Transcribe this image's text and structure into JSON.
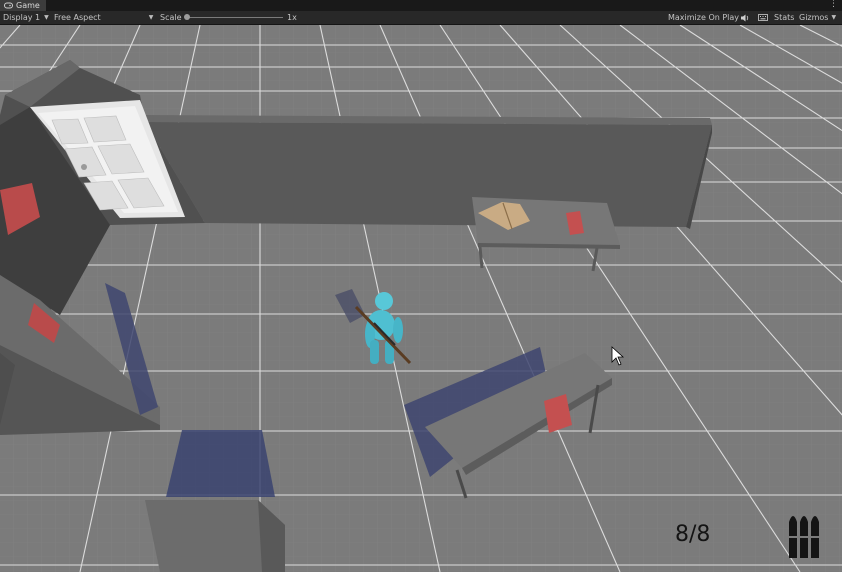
{
  "tab": {
    "title": "Game",
    "icon": "gamepad-icon"
  },
  "toolbar": {
    "display": "Display 1",
    "aspect": "Free Aspect",
    "scale_label": "Scale",
    "scale_value": "1x",
    "maximize": "Maximize On Play",
    "stats": "Stats",
    "gizmos": "Gizmos"
  },
  "hud": {
    "ammo": "8/8",
    "ammo_icon": "bullets-icon"
  },
  "colors": {
    "floor": "#7a7a7a",
    "wall": "#5c5c5c",
    "player": "#52c7d6",
    "book_red": "#c84a4a"
  }
}
